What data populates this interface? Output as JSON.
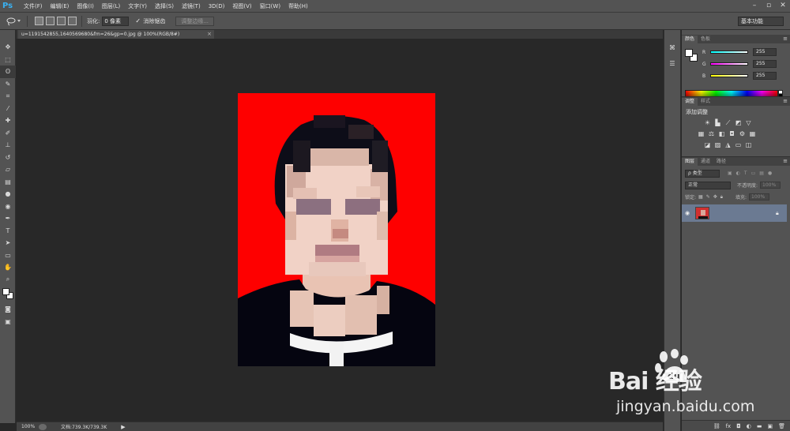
{
  "app": {
    "logo": "Ps"
  },
  "menu": [
    "文件(F)",
    "编辑(E)",
    "图像(I)",
    "图层(L)",
    "文字(Y)",
    "选择(S)",
    "滤镜(T)",
    "3D(D)",
    "视图(V)",
    "窗口(W)",
    "帮助(H)"
  ],
  "options": {
    "feather_label": "羽化:",
    "feather_value": "0 像素",
    "antialias_label": "消除锯齿",
    "refine_edge_label": "调整边缘...",
    "workspace": "基本功能"
  },
  "document": {
    "tab_title": "u=1191542855,1640569680&fm=26&gp=0.jpg @ 100%(RGB/8#)"
  },
  "status": {
    "zoom": "100%",
    "doc_info": "文档:739.3K/739.3K"
  },
  "panels": {
    "color_tab": "颜色",
    "swatches_tab": "色板",
    "r_label": "R",
    "r_value": "255",
    "g_label": "G",
    "g_value": "255",
    "b_label": "B",
    "b_value": "255",
    "adjust_tab": "调整",
    "styles_tab": "样式",
    "adjust_title": "添加调整",
    "layers_tab": "图层",
    "channels_tab": "通道",
    "paths_tab": "路径",
    "filter_kind": "ρ 类型",
    "blend_mode": "正常",
    "opacity_label": "不透明度:",
    "opacity_value": "100%",
    "lock_label": "锁定:",
    "fill_label": "填充:",
    "fill_value": "100%"
  },
  "watermark": {
    "logo_text": "Bai  经验",
    "url": "jingyan.baidu.com"
  },
  "colors": {
    "photo_bg": "#fe0000",
    "selection": "#6b7a92",
    "ui_gray": "#535353",
    "canvas_bg": "#282828"
  }
}
